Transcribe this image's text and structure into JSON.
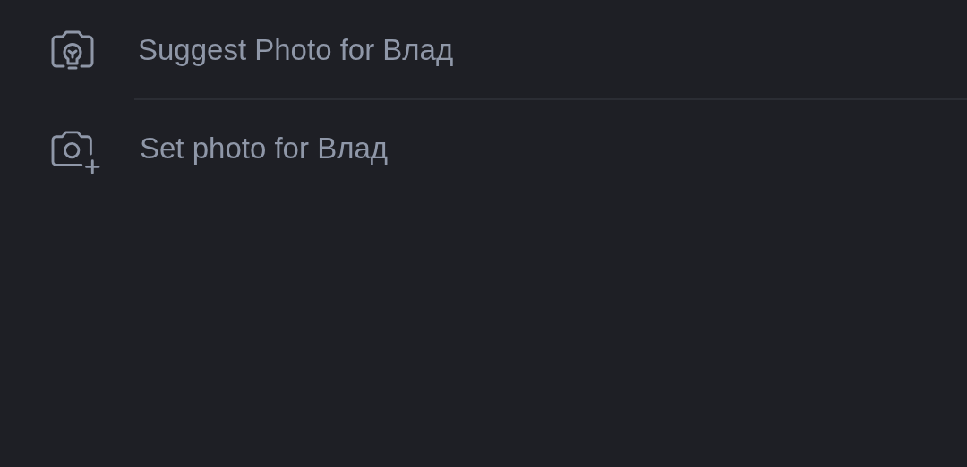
{
  "menu_items": [
    {
      "kind": "suggest",
      "label": "Suggest Photo for Влад"
    },
    {
      "kind": "set",
      "label": "Set photo for Влад"
    }
  ]
}
